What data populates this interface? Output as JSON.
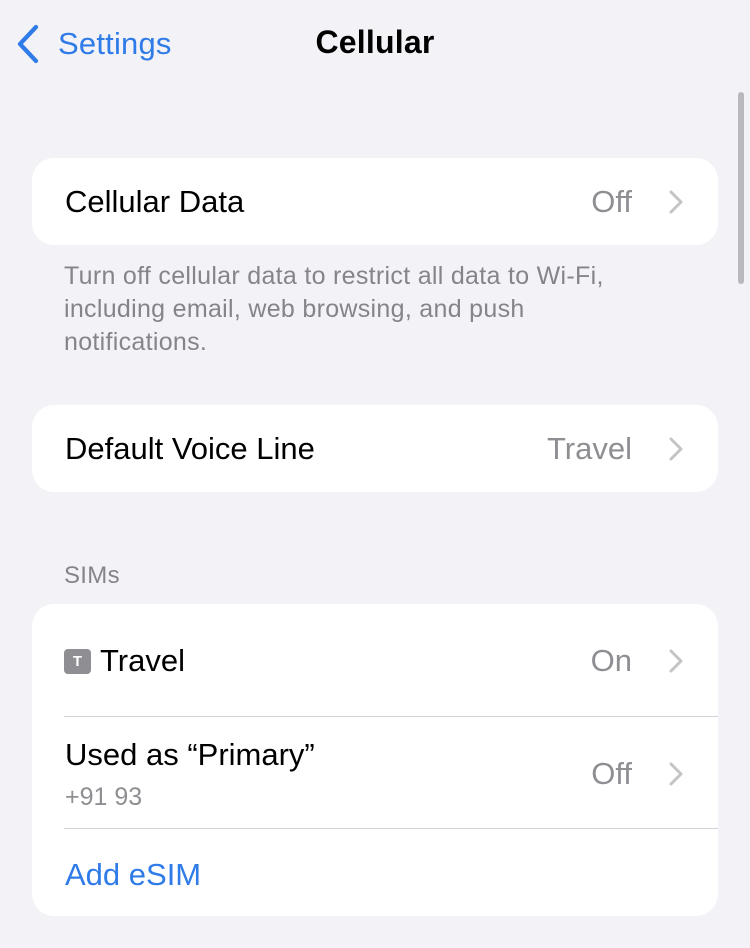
{
  "nav": {
    "back_label": "Settings",
    "title": "Cellular"
  },
  "cellular_data": {
    "label": "Cellular Data",
    "value": "Off",
    "footer": "Turn off cellular data to restrict all data to Wi-Fi, including email, web browsing, and push notifications."
  },
  "default_voice_line": {
    "label": "Default Voice Line",
    "value": "Travel"
  },
  "sims": {
    "header": "SIMs",
    "items": [
      {
        "badge": "T",
        "label": "Travel",
        "value": "On"
      },
      {
        "label": "Used as “Primary”",
        "sublabel": "+91 93",
        "value": "Off"
      }
    ],
    "add_label": "Add eSIM"
  },
  "colors": {
    "accent": "#2f7be8",
    "background": "#f2f2f7",
    "secondary_text": "#8e8e93"
  },
  "icons": {
    "back": "chevron-left-icon",
    "disclosure": "chevron-right-icon"
  }
}
